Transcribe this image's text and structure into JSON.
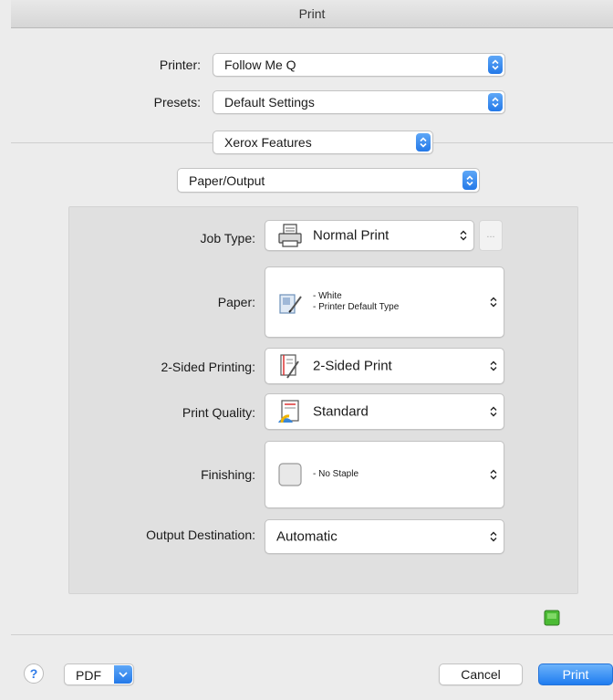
{
  "window": {
    "title": "Print"
  },
  "printer": {
    "label": "Printer:",
    "value": "Follow Me Q"
  },
  "presets": {
    "label": "Presets:",
    "value": "Default Settings"
  },
  "section_menu": {
    "value": "Xerox Features"
  },
  "sub_menu": {
    "value": "Paper/Output"
  },
  "options": {
    "job_type": {
      "label": "Job Type:",
      "value": "Normal Print",
      "more": "..."
    },
    "paper": {
      "label": "Paper:",
      "line1": "- White",
      "line2": "- Printer Default Type"
    },
    "two_sided": {
      "label": "2-Sided Printing:",
      "value": "2-Sided Print"
    },
    "print_quality": {
      "label": "Print Quality:",
      "value": "Standard"
    },
    "finishing": {
      "label": "Finishing:",
      "value": "- No Staple"
    },
    "output_destination": {
      "label": "Output Destination:",
      "value": "Automatic"
    }
  },
  "footer": {
    "help": "?",
    "pdf": "PDF",
    "cancel": "Cancel",
    "print": "Print"
  },
  "icons": {
    "job_type": "printer-icon",
    "paper": "paper-icon",
    "two_sided": "duplex-page-icon",
    "print_quality": "quality-icon",
    "finishing": "staple-icon",
    "status": "green-status-icon"
  },
  "colors": {
    "accent": "#2479e8",
    "status_green": "#3fae2a"
  }
}
